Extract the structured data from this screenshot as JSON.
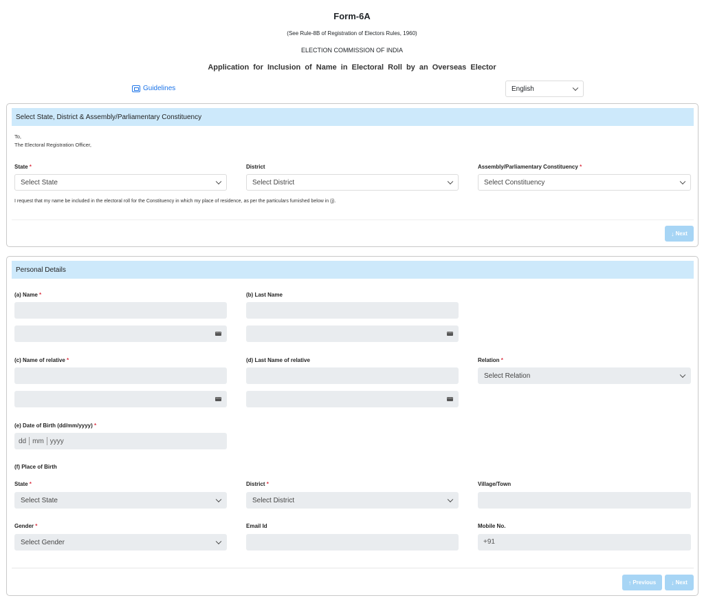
{
  "header": {
    "form_title": "Form-6A",
    "form_subtitle": "(See Rule-8B of Registration of Electors Rules, 1960)",
    "commission": "ELECTION COMMISSION OF INDIA",
    "application_title": "Application for Inclusion of Name in Electoral Roll by an Overseas Elector",
    "guidelines_label": "Guidelines",
    "language_selected": "English"
  },
  "section1": {
    "title": "Select State, District & Assembly/Parliamentary Constituency",
    "to_line": "To,",
    "officer_line": "The Electoral Registration Officer,",
    "state_label": "State",
    "state_placeholder": "Select State",
    "district_label": "District",
    "district_placeholder": "Select District",
    "constituency_label": "Assembly/Parliamentary Constituency",
    "constituency_placeholder": "Select Constituency",
    "request_text": "I request that my name be included in the electoral roll for the Constituency in which my place of residence, as per the particulars furnished below in (j).",
    "next_label": "Next"
  },
  "section2": {
    "title": "Personal Details",
    "name_label": "(a) Name",
    "last_name_label": "(b) Last Name",
    "relative_name_label": "(c) Name of relative",
    "relative_last_name_label": "(d) Last Name of relative",
    "relation_label": "Relation",
    "relation_placeholder": "Select Relation",
    "dob_label": "(e) Date of Birth (dd/mm/yyyy)",
    "dob_dd": "dd",
    "dob_mm": "mm",
    "dob_yyyy": "yyyy",
    "place_of_birth_label": "(f) Place of Birth",
    "pob_state_label": "State",
    "pob_state_placeholder": "Select State",
    "pob_district_label": "District",
    "pob_district_placeholder": "Select District",
    "village_label": "Village/Town",
    "gender_label": "Gender",
    "gender_placeholder": "Select Gender",
    "email_label": "Email Id",
    "mobile_label": "Mobile No.",
    "mobile_value": "+91",
    "previous_label": "Previous",
    "next_label": "Next"
  },
  "required_marker": "*",
  "colors": {
    "header_bg": "#cde9fb",
    "button_bg": "#a7d5f5",
    "link": "#1a73e8",
    "required": "#dc3545",
    "input_bg": "#e9ecef"
  }
}
